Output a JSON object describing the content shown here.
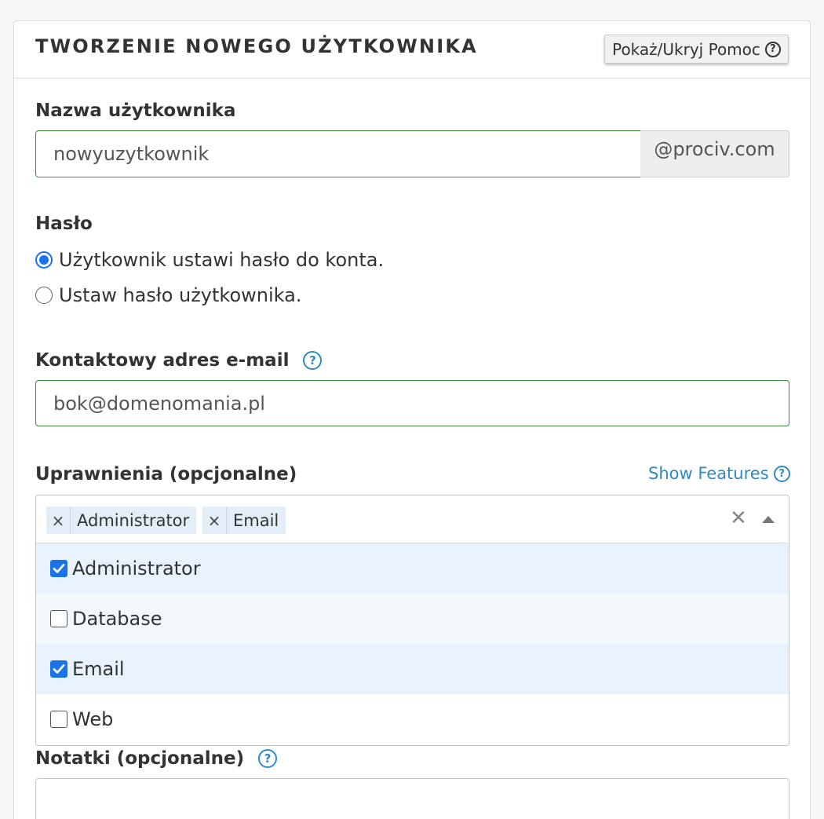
{
  "header": {
    "title": "TWORZENIE NOWEGO UŻYTKOWNIKA",
    "help_toggle_label": "Pokaż/Ukryj Pomoc"
  },
  "username": {
    "label": "Nazwa użytkownika",
    "value": "nowyuzytkownik",
    "domain_suffix": "@prociv.com"
  },
  "password": {
    "label": "Hasło",
    "options": [
      {
        "label": "Użytkownik ustawi hasło do konta.",
        "checked": true
      },
      {
        "label": "Ustaw hasło użytkownika.",
        "checked": false
      }
    ]
  },
  "contact_email": {
    "label": "Kontaktowy adres e-mail",
    "value": "bok@domenomania.pl"
  },
  "permissions": {
    "label": "Uprawnienia (opcjonalne)",
    "show_features_label": "Show Features",
    "selected_tags": [
      "Administrator",
      "Email"
    ],
    "options": [
      {
        "label": "Administrator",
        "checked": true
      },
      {
        "label": "Database",
        "checked": false
      },
      {
        "label": "Email",
        "checked": true
      },
      {
        "label": "Web",
        "checked": false
      }
    ]
  },
  "notes": {
    "label": "Notatki (opcjonalne)",
    "value": ""
  },
  "icons": {
    "help_toggle": "question-circle-icon",
    "field_help": "question-circle-icon",
    "tag_remove": "times-icon",
    "clear": "close-icon",
    "dropdown": "caret-up-icon",
    "checkbox_checked": "check-icon"
  },
  "colors": {
    "accent": "#1a73e8",
    "link": "#2c8ac4",
    "valid_border": "#3c8b3c",
    "selected_row": "#e8f2fc",
    "tag_bg": "#e4eef8"
  }
}
